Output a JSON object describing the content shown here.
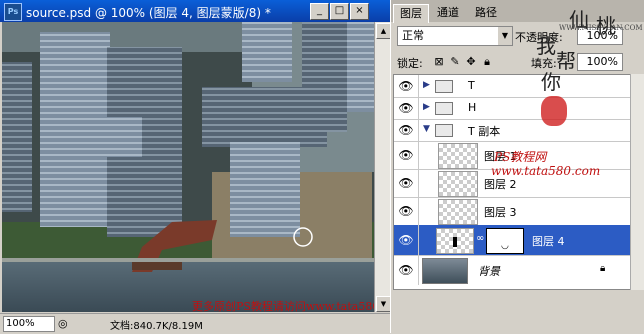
{
  "document": {
    "title": "source.psd @ 100% (图层 4, 图层蒙版/8) *",
    "zoom": "100%",
    "doc_info": "文档:840.7K/8.19M",
    "app_icon": "Ps"
  },
  "layers_panel": {
    "tabs": [
      "图层",
      "通道",
      "路径"
    ],
    "blend_mode": "正常",
    "opacity_label": "不透明度:",
    "opacity": "100%",
    "lock_label": "锁定:",
    "fill_label": "填充:",
    "fill": "100%",
    "layers": [
      {
        "name": "T",
        "type": "group",
        "expanded": false
      },
      {
        "name": "H",
        "type": "group",
        "expanded": false
      },
      {
        "name": "T 副本",
        "type": "group",
        "expanded": true
      },
      {
        "name": "图层 1",
        "type": "layer"
      },
      {
        "name": "图层 2",
        "type": "layer"
      },
      {
        "name": "图层 3",
        "type": "layer"
      },
      {
        "name": "图层 4",
        "type": "layer-mask",
        "selected": true
      },
      {
        "name": "背景",
        "type": "background",
        "locked": true
      }
    ]
  },
  "watermarks": {
    "vertical_1": "仙",
    "vertical_2": "桃",
    "vertical_3": "我",
    "vertical_4": "帮",
    "vertical_5": "你",
    "site_url": "WWW.MISSYUAN.COM",
    "ps_label": "PS教程网",
    "tata_url": "www.tata580.com",
    "footer": "更多原创PS教程请访问www.tata580.com 及 仙桃帮你网站"
  },
  "colors": {
    "title_bar": "#0a4fc4",
    "selected_layer": "#2c5cc4",
    "watermark_red": "#c01010"
  }
}
